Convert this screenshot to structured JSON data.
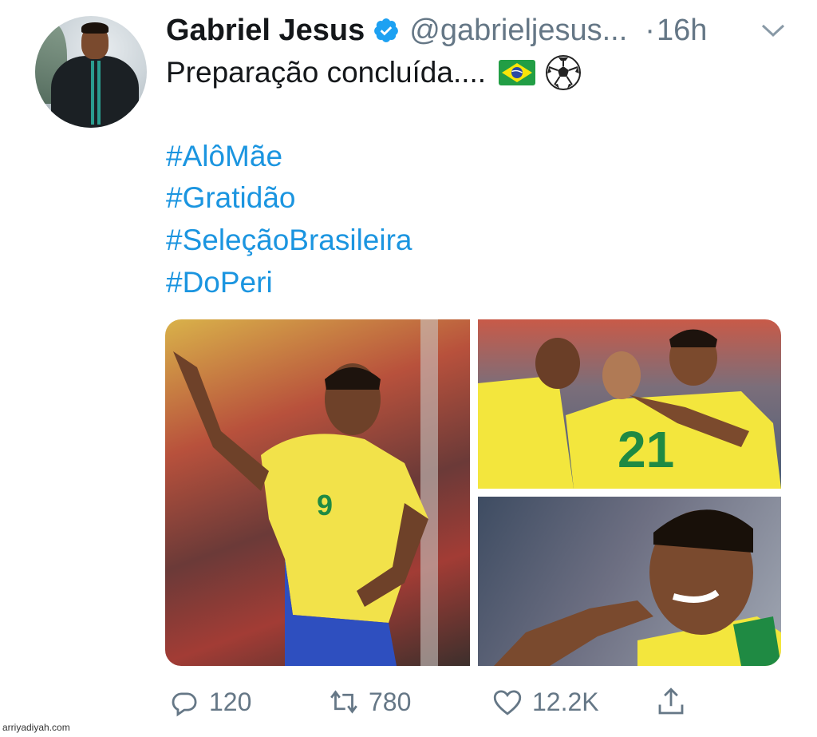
{
  "tweet": {
    "author_name": "Gabriel Jesus",
    "author_handle": "@gabrieljesus...",
    "separator": "·",
    "time": "16h",
    "text_line": "Preparação concluída....",
    "hashtags": [
      "#AlôMãe",
      "#Gratidão",
      "#SeleçãoBrasileira",
      "#DoPeri"
    ],
    "emoji": [
      "brazil-flag",
      "soccer-ball"
    ]
  },
  "actions": {
    "reply_count": "120",
    "retweet_count": "780",
    "like_count": "12.2K"
  },
  "watermark": "arriyadiyah.com",
  "colors": {
    "link": "#1b95e0",
    "muted": "#657786",
    "verified": "#1da1f2",
    "text": "#14171a"
  }
}
